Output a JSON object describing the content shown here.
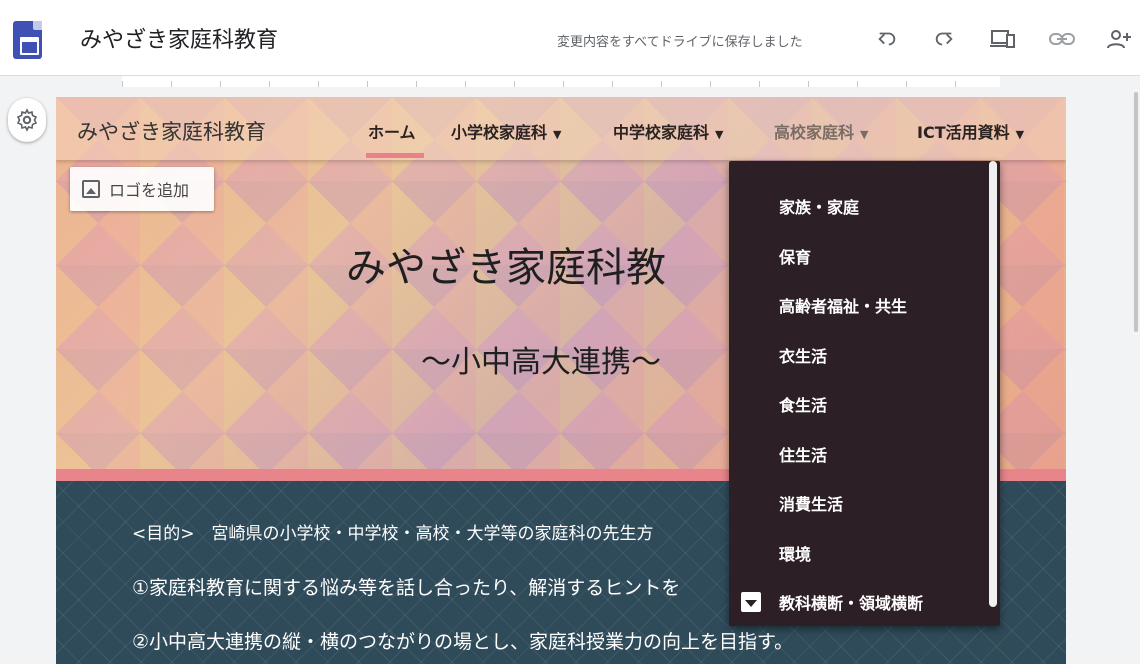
{
  "app": {
    "title": "みやざき家庭科教育",
    "save_status": "変更内容をすべてドライブに保存しました",
    "toolbar_icons": [
      "undo-icon",
      "redo-icon",
      "preview-icon",
      "link-icon",
      "add-person-icon"
    ]
  },
  "site": {
    "title": "みやざき家庭科教育",
    "nav": [
      {
        "label": "ホーム",
        "has_menu": false
      },
      {
        "label": "小学校家庭科",
        "has_menu": true
      },
      {
        "label": "中学校家庭科",
        "has_menu": true
      },
      {
        "label": "高校家庭科",
        "has_menu": true
      },
      {
        "label": "ICT活用資料",
        "has_menu": true
      }
    ],
    "add_logo_label": "ロゴを追加",
    "hero_title": "みやざき家庭科教",
    "hero_subtitle": "〜小中高大連携〜",
    "body": [
      "<目的>　宮崎県の小学校・中学校・高校・大学等の家庭科の先生方",
      "①家庭科教育に関する悩み等を話し合ったり、解消するヒントを",
      "②小中高大連携の縦・横のつながりの場とし、家庭科授業力の向上を目指す。"
    ]
  },
  "dropdown": {
    "items": [
      "家族・家庭",
      "保育",
      "高齢者福祉・共生",
      "衣生活",
      "食生活",
      "住生活",
      "消費生活",
      "環境",
      "教科横断・領域横断"
    ]
  },
  "colors": {
    "accent_pink": "#e8818a",
    "dropdown_bg": "#2c1f26",
    "content_bg": "#2f4b5a",
    "app_logo": "#3f51b5"
  }
}
